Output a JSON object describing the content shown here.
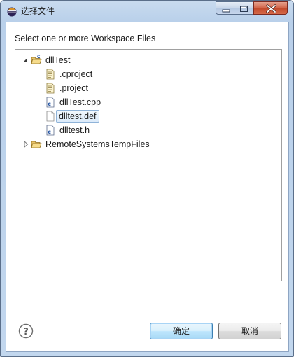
{
  "window": {
    "title": "选择文件",
    "icon": "eclipse-icon"
  },
  "dialog": {
    "prompt": "Select one or more Workspace Files"
  },
  "tree": {
    "nodes": [
      {
        "label": "dllTest",
        "icon": "c-project-folder-icon",
        "expanded": true,
        "level": 0
      },
      {
        "label": ".cproject",
        "icon": "file-icon",
        "level": 1
      },
      {
        "label": ".project",
        "icon": "file-icon",
        "level": 1
      },
      {
        "label": "dllTest.cpp",
        "icon": "c-source-file-icon",
        "level": 1
      },
      {
        "label": "dlltest.def",
        "icon": "plain-file-icon",
        "level": 1,
        "selected": true
      },
      {
        "label": "dlltest.h",
        "icon": "c-header-file-icon",
        "level": 1
      },
      {
        "label": "RemoteSystemsTempFiles",
        "icon": "folder-icon",
        "expanded": false,
        "level": 0
      }
    ]
  },
  "buttons": {
    "ok_label": "确定",
    "cancel_label": "取消"
  },
  "colors": {
    "title_bar": "#b9d0ea",
    "selection_border": "#8fb3d8",
    "close_button": "#c24a2c"
  }
}
